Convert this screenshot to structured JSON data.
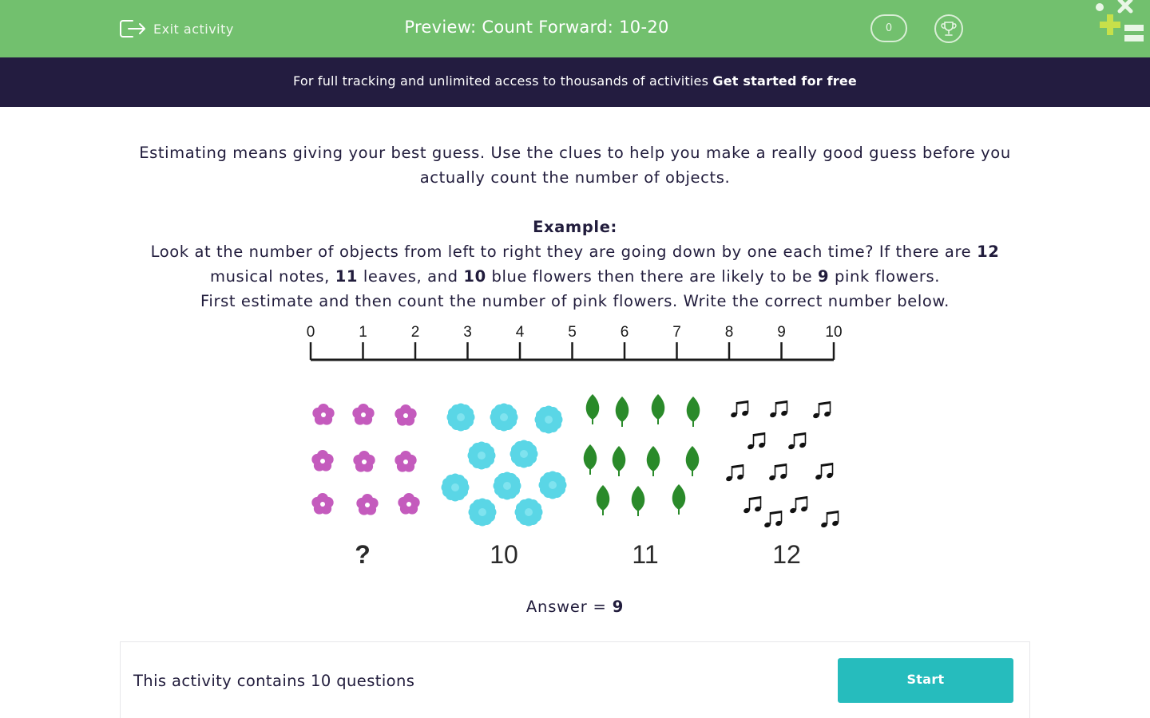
{
  "header": {
    "exit_label": "Exit activity",
    "title": "Preview: Count Forward: 10-20",
    "score": "0"
  },
  "promo": {
    "text": "For full tracking and unlimited access to thousands of activities ",
    "cta": "Get started for free"
  },
  "question": {
    "intro": "Estimating means giving your best guess. Use the clues to help you make a really good guess before you actually count the number of objects.",
    "example_heading": "Example:",
    "line1_a": "Look at the number of objects from left to right they are going down by one each time? If there are ",
    "line1_b": "12",
    "line1_c": " musical notes, ",
    "line1_d": "11",
    "line1_e": " leaves, and ",
    "line1_f": "10",
    "line1_g": " blue flowers then there are likely to be ",
    "line1_h": "9",
    "line1_i": " pink flowers.",
    "line2": "First estimate and then count the number of pink flowers. Write the correct number below."
  },
  "figure": {
    "number_line_labels": [
      "0",
      "1",
      "2",
      "3",
      "4",
      "5",
      "6",
      "7",
      "8",
      "9",
      "10"
    ],
    "group_labels": [
      "?",
      "10",
      "11",
      "12"
    ],
    "colors": {
      "pink_flower": "#c45bbd",
      "blue_flower": "#5ad6e6",
      "leaf": "#2a8a2a",
      "note": "#111111"
    }
  },
  "answer": {
    "label": "Answer = ",
    "value": "9"
  },
  "footer": {
    "text": "This activity contains 10 questions",
    "start_label": "Start"
  },
  "colors": {
    "topbar": "#72c06e",
    "promo_bar": "#231c40",
    "start_button": "#26bcbd"
  }
}
